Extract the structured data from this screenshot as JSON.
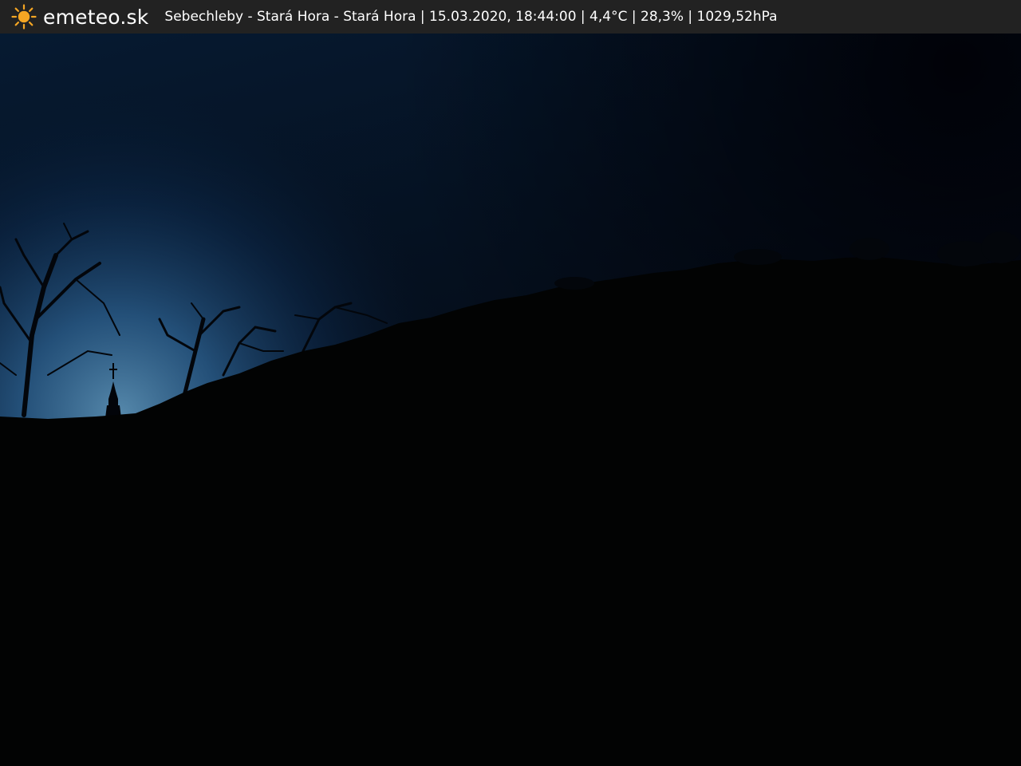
{
  "overlay": {
    "brand_icon": "sun-icon",
    "brand_name": "emeteo.sk",
    "caption": "Sebechleby - Stará Hora - Stará Hora | 15.03.2020, 18:44:00 | 4,4°C | 28,3% | 1029,52hPa"
  },
  "colors": {
    "bar_background": "#222222",
    "bar_text": "#ffffff",
    "sun": "#f5a623",
    "sky_top": "#02040d",
    "sky_horizon": "#2a5f8c",
    "ground": "#020202"
  }
}
